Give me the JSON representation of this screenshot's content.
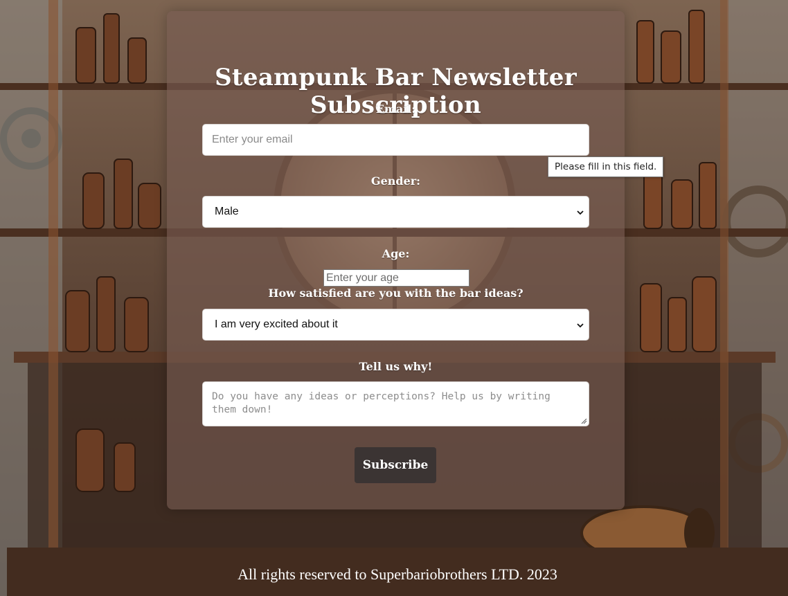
{
  "form": {
    "title": "Steampunk Bar Newsletter Subscription",
    "email_label": "Email:",
    "email_placeholder": "Enter your email",
    "gender_label": "Gender:",
    "gender_selected": "Male",
    "age_label": "Age:",
    "age_placeholder": "Enter your age",
    "satisfaction_label": "How satisfied are you with the bar ideas?",
    "satisfaction_selected": "I am very excited about it",
    "why_label": "Tell us why!",
    "why_placeholder": "Do you have any ideas or perceptions? Help us by writing them down!",
    "submit_label": "Subscribe"
  },
  "validation_tooltip": "Please fill in this field.",
  "footer": {
    "text": "All rights reserved to Superbariobrothers LTD. 2023"
  },
  "colors": {
    "footer_bg": "#432c1f",
    "button_bg": "#3b3433",
    "card_overlay": "rgba(120,92,82,0.62)"
  },
  "icons": {
    "select_arrow": "chevron-down-icon",
    "resize_handle": "resize-grip-icon"
  }
}
